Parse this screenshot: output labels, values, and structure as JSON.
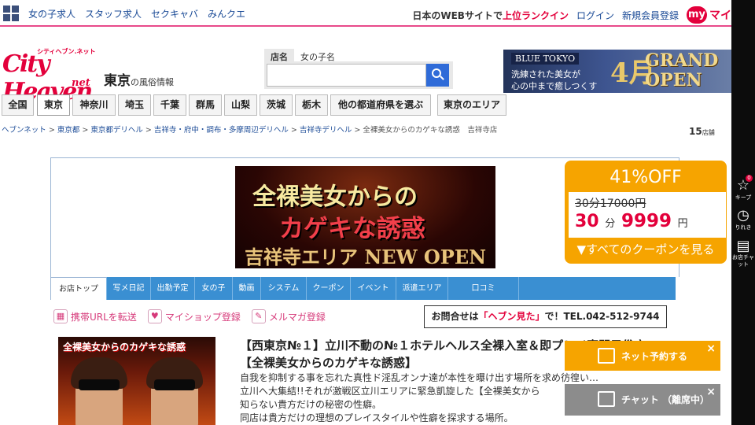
{
  "header": {
    "links": [
      "女の子求人",
      "スタッフ求人",
      "セクキャバ",
      "みんクエ"
    ],
    "ranking_prefix": "日本のWEBサイトで",
    "ranking_highlight": "上位ランクイン",
    "login": "ログイン",
    "register": "新規会員登録",
    "my_badge": "my",
    "my_label": "マイ"
  },
  "logo": {
    "main": "City Heaven",
    "sub": "シティヘブン.ネット",
    "net": "net"
  },
  "area": {
    "name": "東京",
    "suffix": "の風俗情報"
  },
  "search": {
    "tabs": [
      "店名",
      "女の子名"
    ],
    "placeholder": ""
  },
  "top_banner": {
    "brand": "BLUE TOKYO",
    "line1": "洗練された美女が",
    "line2": "心の中まで癒しつくす",
    "big": "4月",
    "grand": "GRAND OPEN"
  },
  "prefectures": [
    "全国",
    "東京",
    "神奈川",
    "埼玉",
    "千葉",
    "群馬",
    "山梨",
    "茨城",
    "栃木",
    "他の都道府県を選ぶ",
    "東京のエリア"
  ],
  "breadcrumb": [
    "ヘブンネット",
    "東京都",
    "東京都デリヘル",
    "吉祥寺・府中・調布・多摩周辺デリヘル",
    "吉祥寺デリヘル",
    "全裸美女からのカゲキな誘惑　吉祥寺店"
  ],
  "shop_count": {
    "num": "15",
    "unit": "店舗"
  },
  "shop_banner": {
    "line1": "全裸美女からの",
    "line2": "カゲキな誘惑",
    "line3": "吉祥寺エリア NEW OPEN"
  },
  "coupon": {
    "discount": "41%OFF",
    "old_price": "30分17000円",
    "new_minutes": "30",
    "new_minutes_unit": "分",
    "new_price": "9999",
    "yen": "円",
    "all_label": "▼すべてのクーポンを見る"
  },
  "shop_tabs": [
    "お店トップ",
    "写メ日記",
    "出勤予定",
    "女の子",
    "動画",
    "システム",
    "クーポン",
    "イベント",
    "派遣エリア",
    "口コミ"
  ],
  "actions": [
    "携帯URLを転送",
    "マイショップ登録",
    "メルマガ登録"
  ],
  "contact": {
    "prefix": "お問合せは",
    "highlight": "「ヘブン見た」",
    "suffix": "で！TEL.042-512-9744"
  },
  "shop_thumb_title": "全裸美女からのカゲキな誘惑",
  "shop_title": "【西東京№１】立川不動の№１ホテルヘルス全裸入室＆即プレイ専門風俗店【全裸美女からのカゲキな誘惑】",
  "shop_desc": [
    "自我を抑制する事を忘れた真性ド淫乱オンナ達が本性を曝け出す場所を求め彷徨い…",
    "立川へ大集結!!それが激戦区立川エリアに緊急凱旋した【全裸美女から",
    "知らない貴方だけの秘密の性癖。",
    "同店は貴方だけの理想のプレイスタイルや性癖を探求する場所。"
  ],
  "floating": {
    "reserve": "ネット予約する",
    "chat": "チャット （離席中）",
    "close": "×"
  },
  "right_strip": {
    "keep": "キープ",
    "history": "りれき",
    "chat": "お店チャット",
    "badge": "0"
  }
}
